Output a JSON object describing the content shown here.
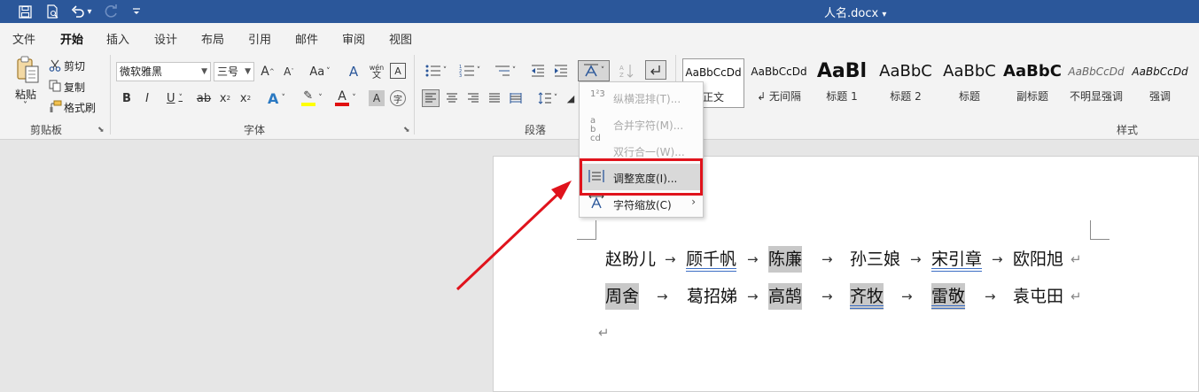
{
  "window": {
    "title": "人名.docx",
    "title_dropdown": "▾"
  },
  "quick_access": {
    "save_icon": "save-icon",
    "print_preview_icon": "print-preview-icon",
    "undo_icon": "undo-icon",
    "undo_dropdown": "▾",
    "redo_icon": "redo-icon",
    "customize_icon": "customize-icon"
  },
  "ribbon_tabs": [
    "文件",
    "开始",
    "插入",
    "设计",
    "布局",
    "引用",
    "邮件",
    "审阅",
    "视图"
  ],
  "active_tab": "开始",
  "clipboard": {
    "paste_label": "粘贴",
    "paste_dropdown": "˅",
    "cut_label": "剪切",
    "copy_label": "复制",
    "format_painter_label": "格式刷",
    "group_label": "剪贴板"
  },
  "font": {
    "font_name": "微软雅黑",
    "font_size": "三号",
    "grow_label": "A",
    "shrink_label": "A",
    "case_label": "Aa",
    "clear_format_label": "A",
    "phonetic_label": "wén",
    "border_char_label": "A",
    "bold": "B",
    "italic": "I",
    "underline": "U",
    "strikethrough": "ab",
    "subscript": "x",
    "superscript": "x",
    "text_effect": "A",
    "highlight": "✎",
    "font_color": "A",
    "shading": "A",
    "enclose": "字",
    "group_label": "字体"
  },
  "paragraph": {
    "group_label": "段落"
  },
  "styles": {
    "items": [
      {
        "sample": "AaBbCcDd",
        "name": "正文"
      },
      {
        "sample": "AaBbCcDd",
        "name": "↲ 无间隔"
      },
      {
        "sample": "AaBl",
        "name": "标题 1"
      },
      {
        "sample": "AaBbC",
        "name": "标题 2"
      },
      {
        "sample": "AaBbC",
        "name": "标题"
      },
      {
        "sample": "AaBbC",
        "name": "副标题"
      },
      {
        "sample": "AaBbCcDd",
        "name": "不明显强调"
      },
      {
        "sample": "AaBbCcDd",
        "name": "强调"
      }
    ],
    "group_label": "样式"
  },
  "menu": {
    "items": [
      {
        "icon": "1²3",
        "label": "纵横混排(T)...",
        "enabled": false
      },
      {
        "icon": "ab cd",
        "label": "合并字符(M)...",
        "enabled": false
      },
      {
        "icon": "",
        "label": "双行合一(W)...",
        "enabled": false
      },
      {
        "icon": "⇔",
        "label": "调整宽度(I)...",
        "enabled": true
      },
      {
        "icon": "A",
        "label": "字符缩放(C)",
        "enabled": true
      }
    ],
    "submenu_arrow": "›"
  },
  "document": {
    "line1": [
      "赵盼儿",
      "顾千帆",
      "陈廉",
      "孙三娘",
      "宋引章",
      "欧阳旭"
    ],
    "line2": [
      "周舍",
      "葛招娣",
      "高鹄",
      "齐牧",
      "雷敬",
      "袁屯田"
    ],
    "tab_arrow": "→",
    "paragraph_mark": "↵"
  },
  "colors": {
    "title_bar": "#2b579a",
    "highlight_box": "#e0131c",
    "annotation_arrow": "#e0131c",
    "shading": "#c8c8c8"
  }
}
